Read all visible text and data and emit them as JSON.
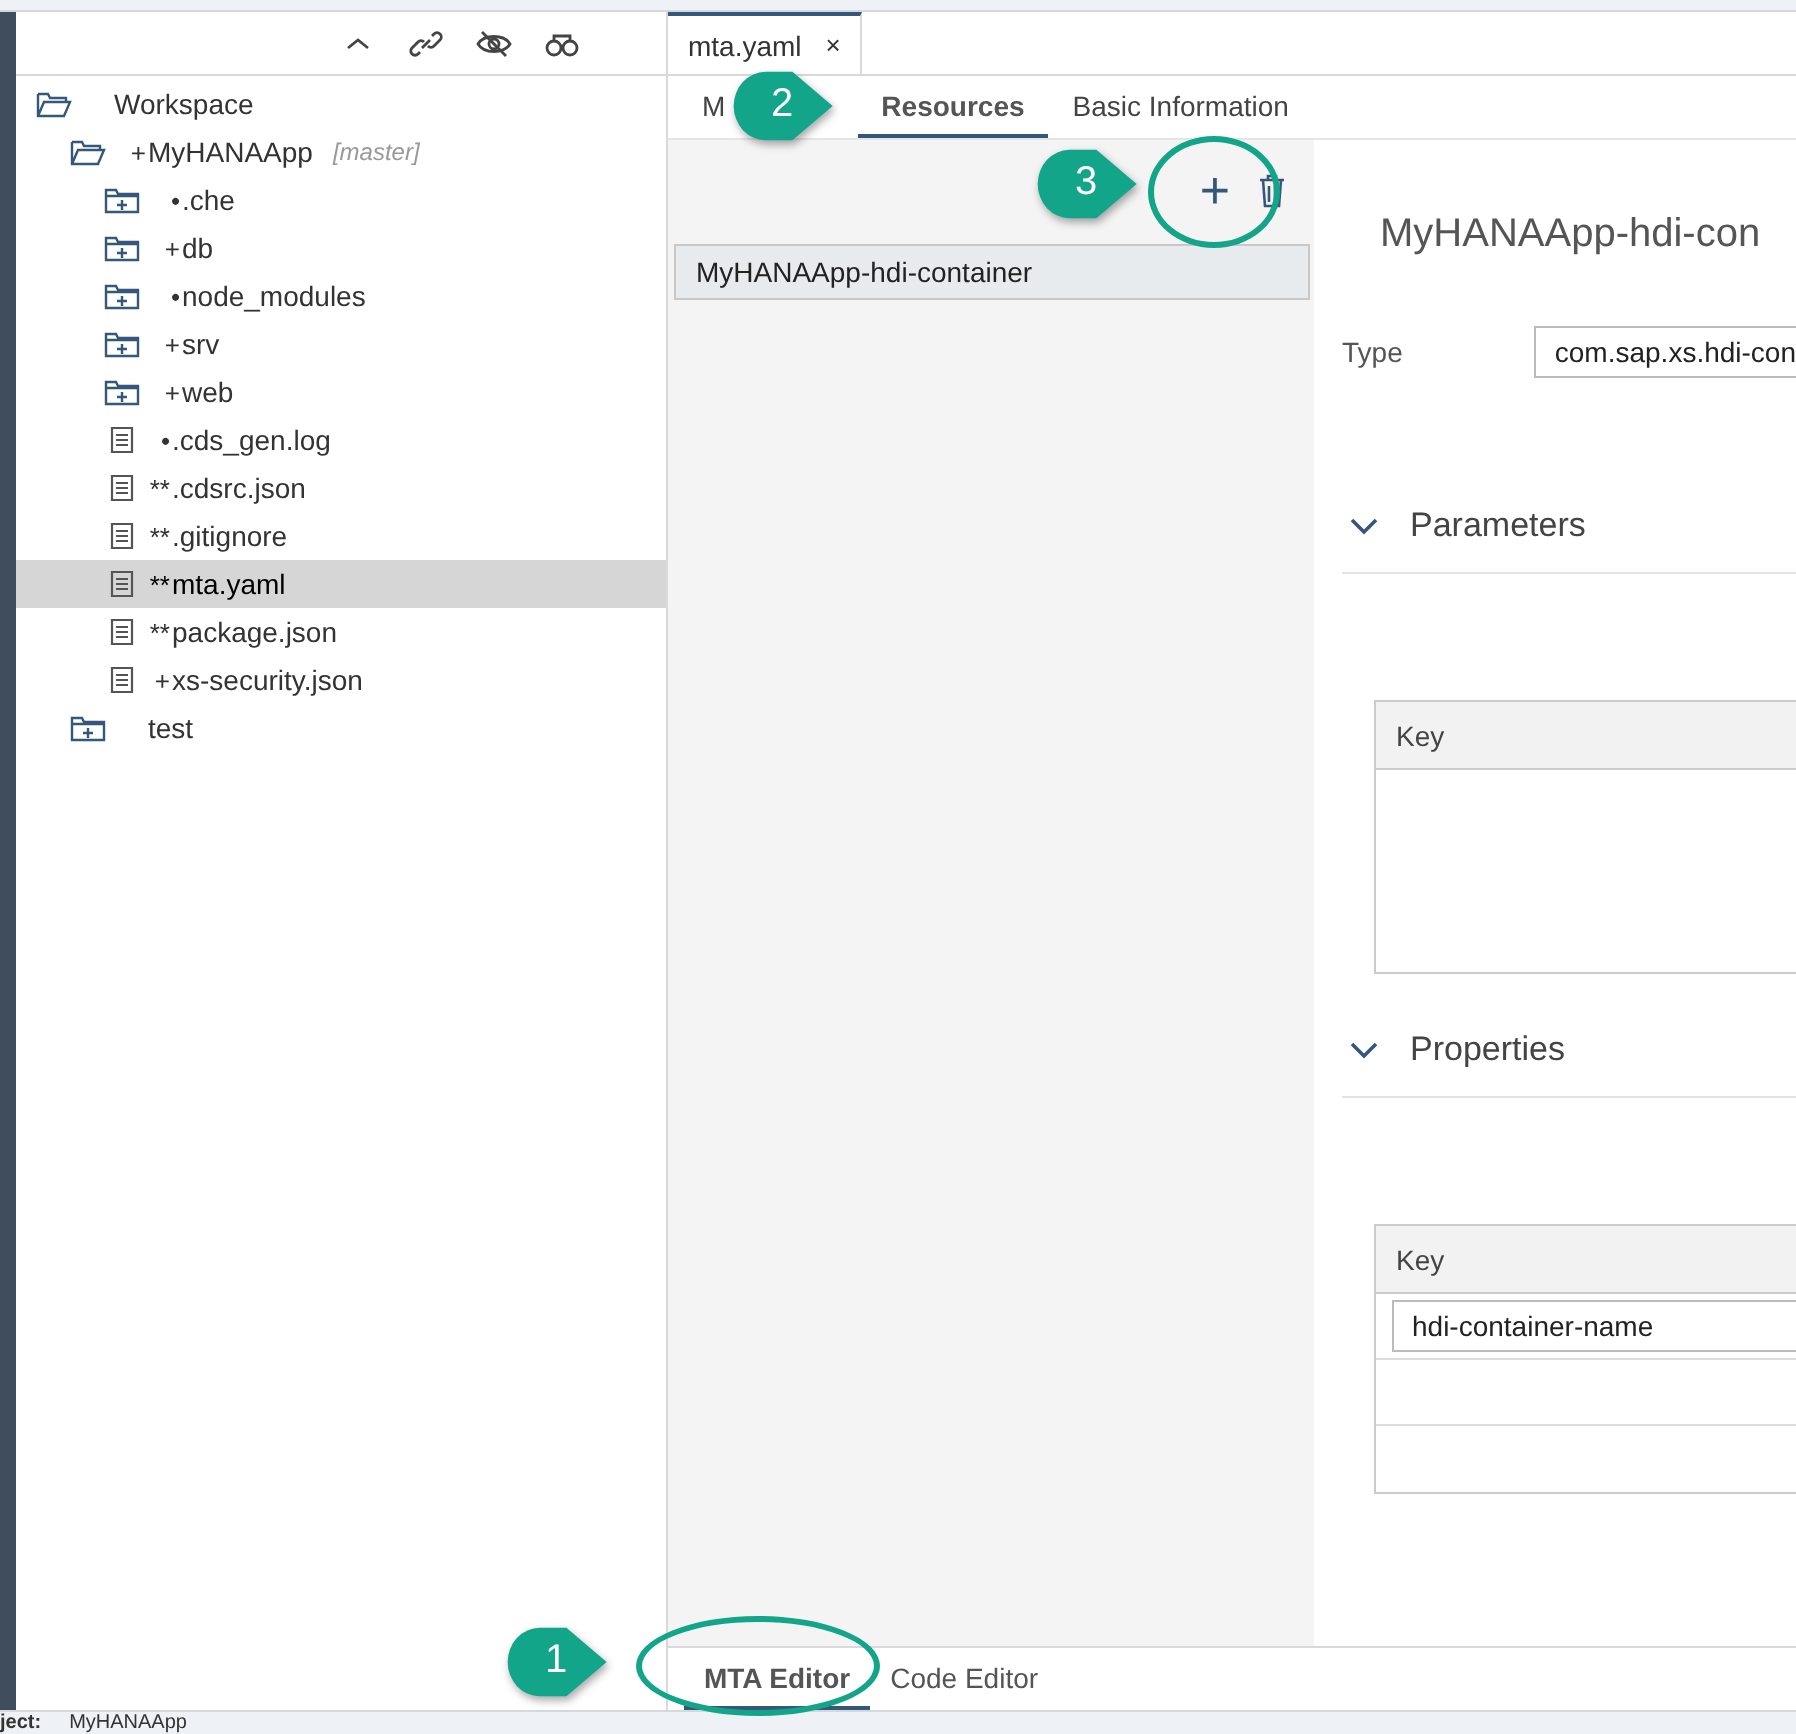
{
  "explorer": {
    "tree": [
      {
        "kind": "folder",
        "label": "Workspace",
        "expanded": true,
        "selected": false,
        "children": [
          {
            "kind": "folder",
            "prefix": "+",
            "label": "MyHANAApp",
            "tag": "[master]",
            "expanded": true,
            "selected": false,
            "children": [
              {
                "kind": "folder",
                "prefix": "•",
                "label": ".che",
                "expanded": false,
                "selected": false
              },
              {
                "kind": "folder",
                "prefix": "+",
                "label": "db",
                "expanded": false,
                "selected": false
              },
              {
                "kind": "folder",
                "prefix": "•",
                "label": "node_modules",
                "expanded": false,
                "selected": false
              },
              {
                "kind": "folder",
                "prefix": "+",
                "label": "srv",
                "expanded": false,
                "selected": false
              },
              {
                "kind": "folder",
                "prefix": "+",
                "label": "web",
                "expanded": false,
                "selected": false
              },
              {
                "kind": "file",
                "prefix": "•",
                "label": ".cds_gen.log",
                "selected": false
              },
              {
                "kind": "file",
                "prefix": "**",
                "label": ".cdsrc.json",
                "selected": false
              },
              {
                "kind": "file",
                "prefix": "**",
                "label": ".gitignore",
                "selected": false
              },
              {
                "kind": "file",
                "prefix": "**",
                "label": "mta.yaml",
                "selected": true
              },
              {
                "kind": "file",
                "prefix": "**",
                "label": "package.json",
                "selected": false
              },
              {
                "kind": "file",
                "prefix": "+",
                "label": "xs-security.json",
                "selected": false
              }
            ]
          },
          {
            "kind": "folder",
            "label": "test",
            "expanded": false,
            "selected": false
          }
        ]
      }
    ]
  },
  "editor_tab": {
    "label": "mta.yaml",
    "close": "×"
  },
  "sub_tabs": [
    {
      "label": "M",
      "selected": false
    },
    {
      "label": "Resources",
      "selected": true
    },
    {
      "label": "Basic Information",
      "selected": false
    }
  ],
  "resources": {
    "add": "+",
    "items": [
      {
        "label": "MyHANAApp-hdi-container",
        "selected": true
      }
    ]
  },
  "detail": {
    "title": "MyHANAApp-hdi-con",
    "type_label": "Type",
    "type_value": "com.sap.xs.hdi-con",
    "sections": [
      {
        "title": "Parameters",
        "expanded": true,
        "key_header": "Key"
      },
      {
        "title": "Properties",
        "expanded": true,
        "key_header": "Key",
        "rows": [
          {
            "key": "hdi-container-name"
          },
          {
            "key": null
          },
          {
            "key": null
          }
        ]
      }
    ]
  },
  "bottom_tabs": [
    {
      "label": "MTA Editor",
      "selected": true
    },
    {
      "label": "Code Editor",
      "selected": false
    }
  ],
  "status_bar": {
    "label": "ject:",
    "value": "MyHANAApp"
  },
  "callouts": [
    {
      "number": "1"
    },
    {
      "number": "2"
    },
    {
      "number": "3"
    }
  ]
}
